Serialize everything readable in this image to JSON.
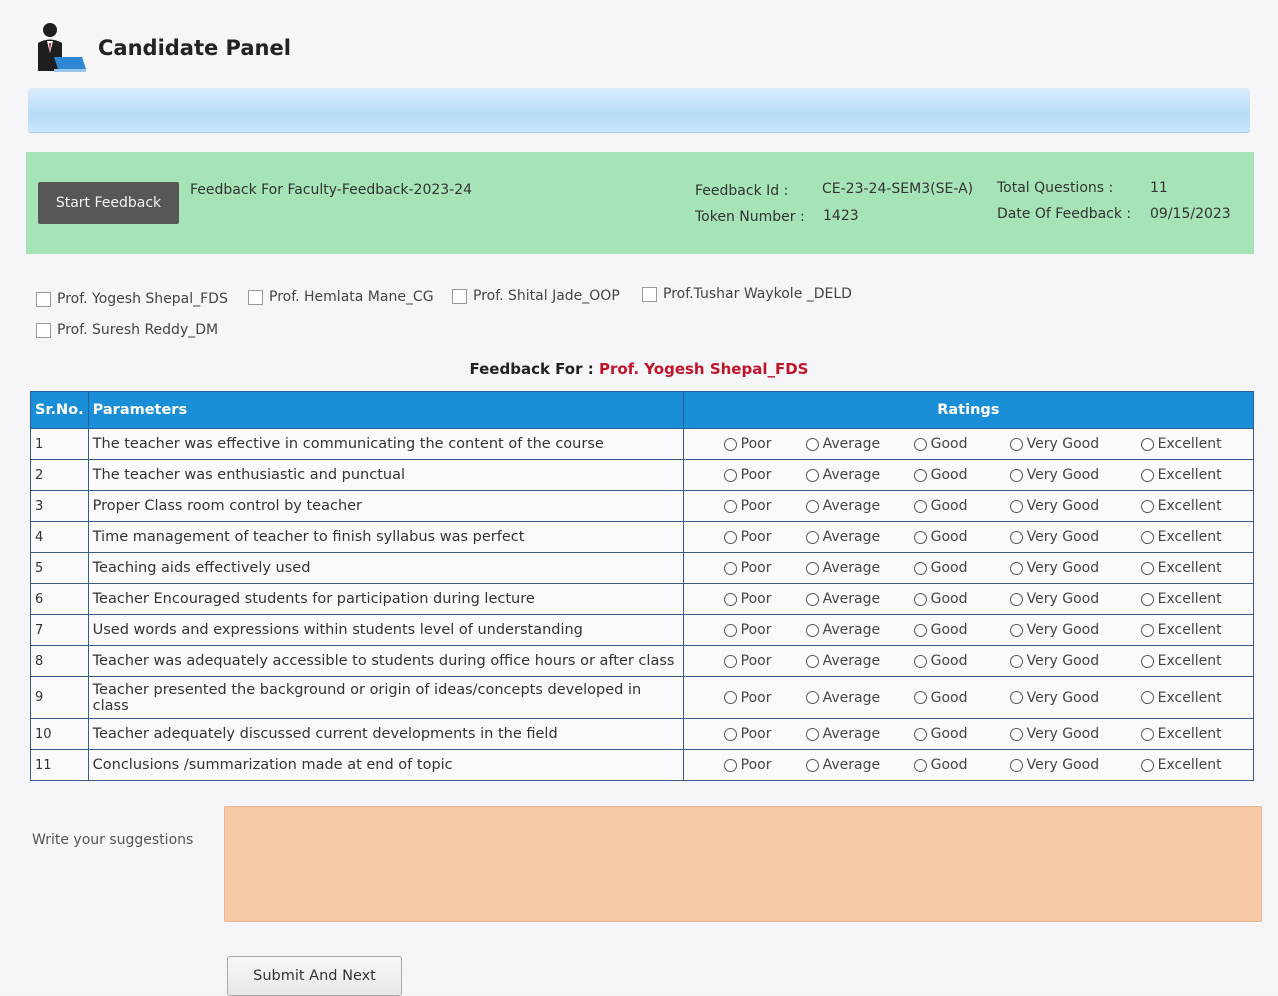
{
  "header": {
    "title": "Candidate Panel",
    "icon": "user-laptop-icon"
  },
  "feedback_bar": {
    "start_button": "Start Feedback",
    "feedback_for": "Feedback For Faculty-Feedback-2023-24",
    "feedback_id_label": "Feedback Id :",
    "feedback_id": "CE-23-24-SEM3(SE-A)",
    "token_label": "Token Number :",
    "token": "1423",
    "total_q_label": "Total Questions :",
    "total_q": "11",
    "date_label": "Date Of Feedback :",
    "date": "09/15/2023"
  },
  "professors": [
    "Prof. Yogesh Shepal_FDS",
    "Prof. Hemlata Mane_CG",
    "Prof. Shital Jade_OOP",
    "Prof.Tushar Waykole _DELD",
    "Prof. Suresh Reddy_DM"
  ],
  "current": {
    "label": "Feedback For :",
    "name": "Prof. Yogesh Shepal_FDS"
  },
  "table": {
    "headers": {
      "srno": "Sr.No.",
      "params": "Parameters",
      "ratings": "Ratings"
    },
    "options": [
      "Poor",
      "Average",
      "Good",
      "Very Good",
      "Excellent"
    ],
    "rows": [
      {
        "no": "1",
        "text": "The teacher was effective in communicating the content of the course"
      },
      {
        "no": "2",
        "text": "The teacher was enthusiastic and punctual"
      },
      {
        "no": "3",
        "text": "Proper Class room control by teacher"
      },
      {
        "no": "4",
        "text": "Time management of teacher to finish syllabus was perfect"
      },
      {
        "no": "5",
        "text": "Teaching aids effectively used"
      },
      {
        "no": "6",
        "text": "Teacher Encouraged students for participation during lecture"
      },
      {
        "no": "7",
        "text": "Used words and expressions within students level of understanding"
      },
      {
        "no": "8",
        "text": "Teacher was adequately accessible to students during office hours or after class"
      },
      {
        "no": "9",
        "text": "Teacher presented the background or origin of ideas/concepts developed in class"
      },
      {
        "no": "10",
        "text": "Teacher adequately discussed current developments in the field"
      },
      {
        "no": "11",
        "text": "Conclusions /summarization made at end of topic"
      }
    ]
  },
  "suggestions": {
    "label": "Write your suggestions",
    "value": ""
  },
  "submit_label": "Submit And Next"
}
